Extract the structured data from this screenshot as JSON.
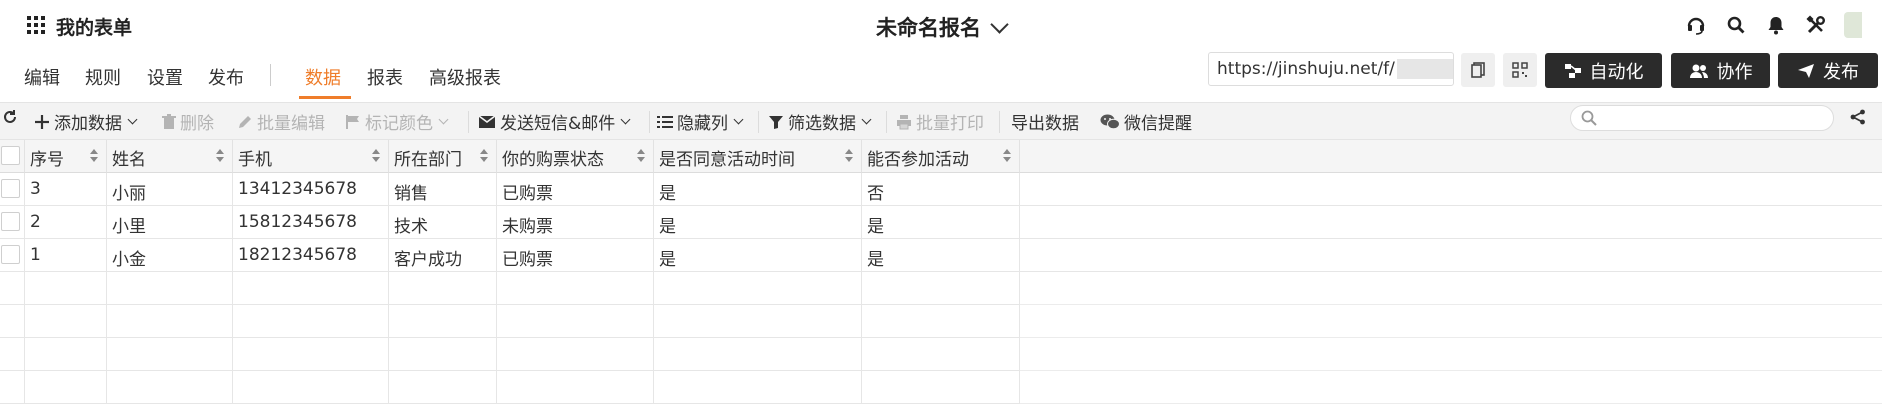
{
  "header": {
    "app_title": "我的表单",
    "form_title": "未命名报名"
  },
  "nav": {
    "tabs": [
      "编辑",
      "规则",
      "设置",
      "发布",
      "数据",
      "报表",
      "高级报表"
    ],
    "active_tab": "数据",
    "url": "https://jinshuju.net/f/",
    "buttons": {
      "automation": "自动化",
      "collab": "协作",
      "publish": "发布"
    }
  },
  "toolbar": {
    "add_data": "添加数据",
    "delete": "删除",
    "batch_edit": "批量编辑",
    "mark_color": "标记颜色",
    "send_sms_mail": "发送短信&邮件",
    "hide_cols": "隐藏列",
    "filter": "筛选数据",
    "batch_print": "批量打印",
    "export": "导出数据",
    "wechat_remind": "微信提醒",
    "search_placeholder": ""
  },
  "table": {
    "columns": [
      "序号",
      "姓名",
      "手机",
      "所在部门",
      "你的购票状态",
      "是否同意活动时间",
      "能否参加活动"
    ],
    "rows": [
      [
        "3",
        "小丽",
        "13412345678",
        "销售",
        "已购票",
        "是",
        "否"
      ],
      [
        "2",
        "小里",
        "15812345678",
        "技术",
        "未购票",
        "是",
        "是"
      ],
      [
        "1",
        "小金",
        "18212345678",
        "客户成功",
        "已购票",
        "是",
        "是"
      ]
    ]
  },
  "colors": {
    "accent": "#ef7d2a",
    "dark_button": "#2b2b2b"
  }
}
